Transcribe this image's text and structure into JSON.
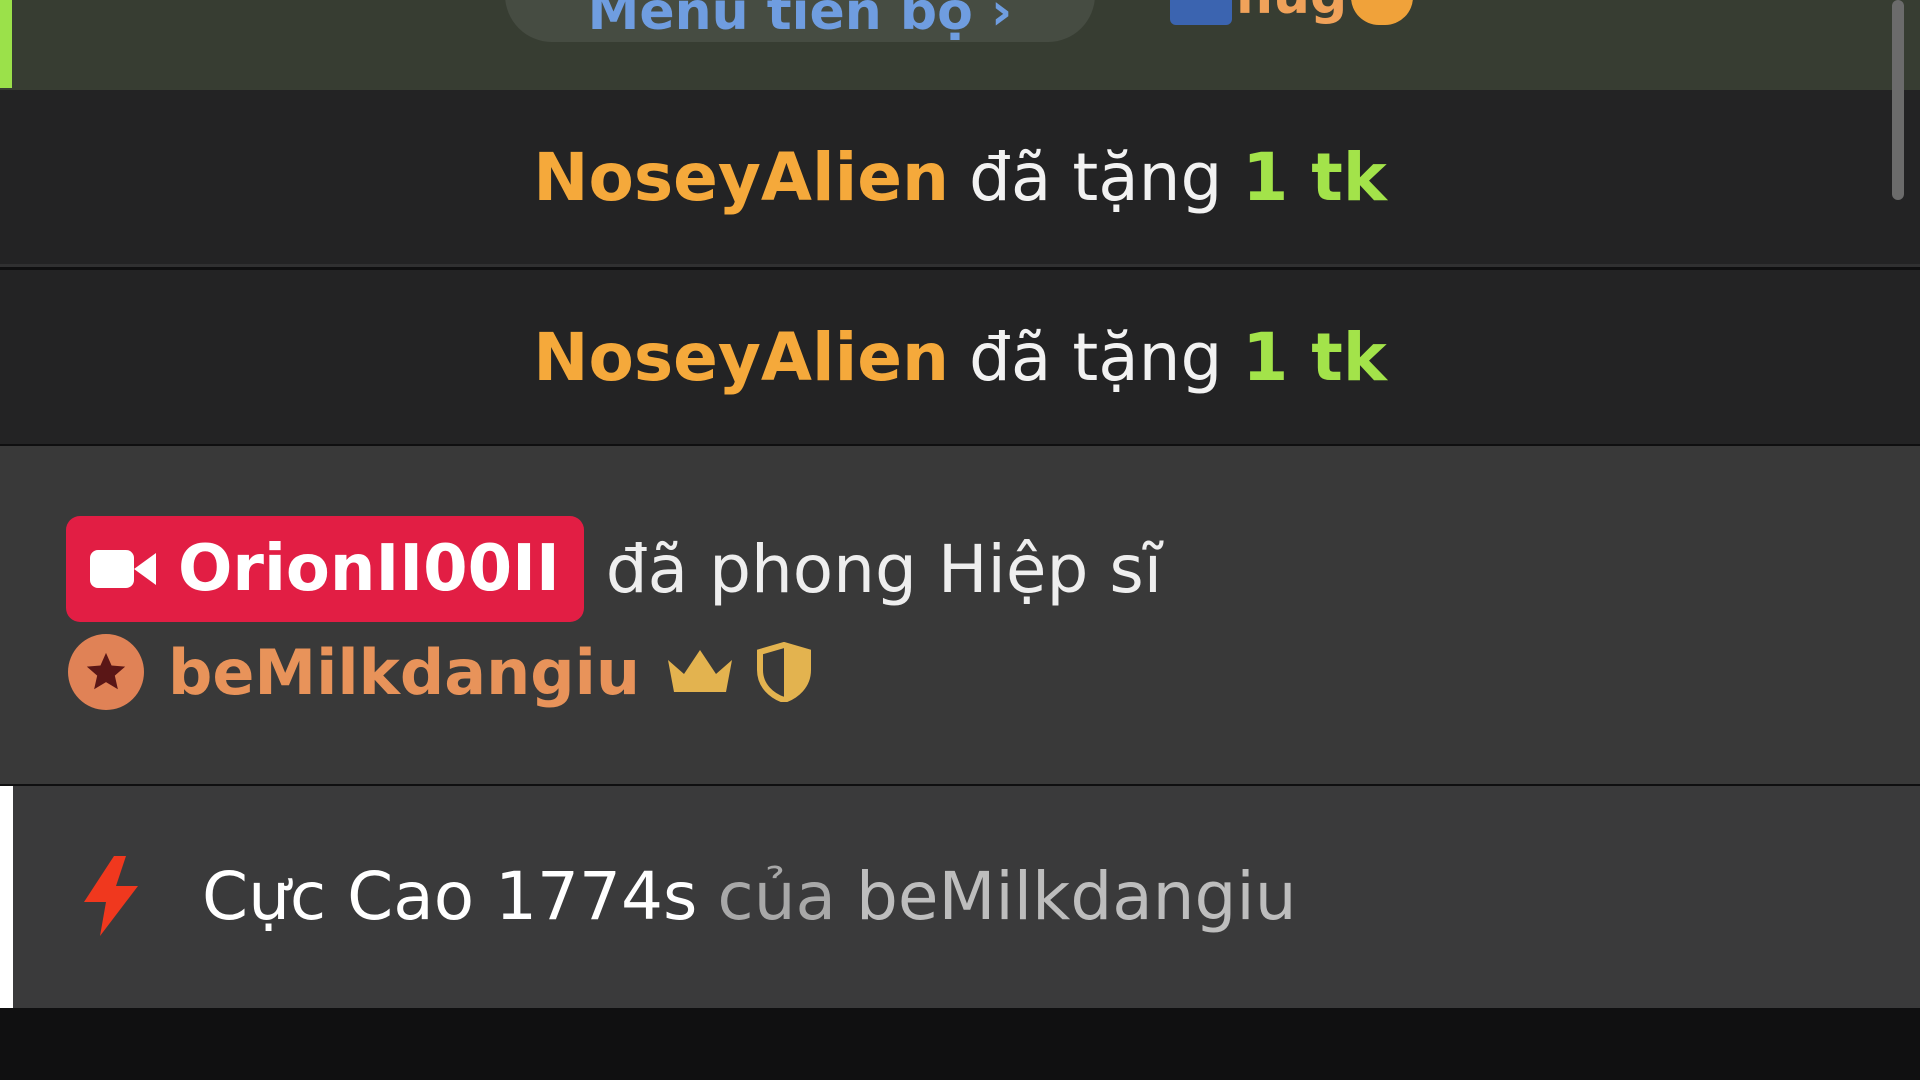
{
  "top": {
    "menu_label": "Menu tiến bộ ›",
    "hug_text": "hug"
  },
  "gifts": [
    {
      "user": "NoseyAlien",
      "verb": "đã tặng",
      "amount": "1 tk"
    },
    {
      "user": "NoseyAlien",
      "verb": "đã tặng",
      "amount": "1 tk"
    }
  ],
  "knight": {
    "badge_name": "OrionII00II",
    "action": "đã phong Hiệp sĩ",
    "target_user": "beMilkdangiu"
  },
  "record": {
    "main": "Cực Cao 1774s",
    "of": "của",
    "user": "beMilkdangiu"
  },
  "colors": {
    "username_gift": "#f5a93b",
    "amount": "#a3e34a",
    "badge_bg": "#e21e44",
    "knight_user": "#e8935a",
    "bolt": "#f0381e"
  }
}
